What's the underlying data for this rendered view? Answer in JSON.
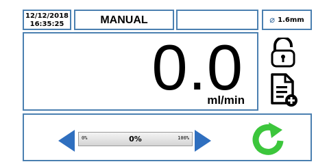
{
  "status_bar": {
    "date": "12/12/2018",
    "time": "16:35:25",
    "mode": "MANUAL",
    "tubing_size": "1.6mm"
  },
  "display": {
    "flow_rate": "0.0",
    "unit": "ml/min"
  },
  "speed_control": {
    "value": "0%",
    "min_label": "0%",
    "max_label": "100%",
    "level": 0
  },
  "icons": {
    "lock": "unlocked-padlock-icon",
    "document": "add-document-icon",
    "decrease": "left-arrow-icon",
    "increase": "right-arrow-icon",
    "restart": "restart-icon"
  },
  "colors": {
    "border": "#4a7fb0",
    "arrow": "#2f6fbf",
    "restart": "#3cc63c"
  }
}
